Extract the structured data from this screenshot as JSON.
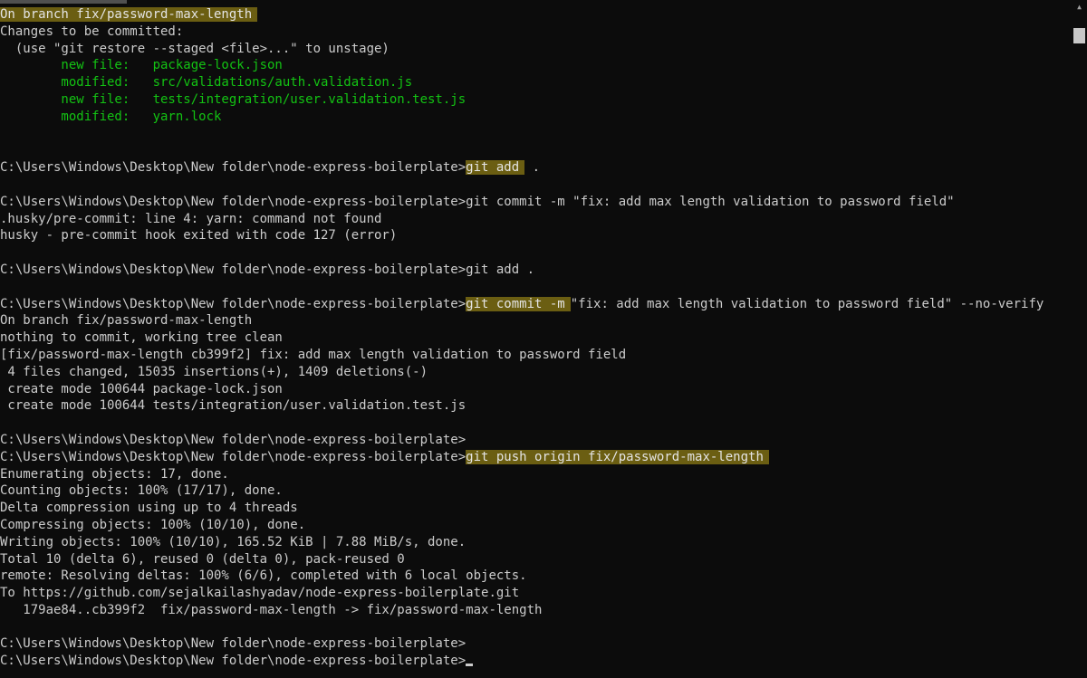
{
  "terminal": {
    "lines": [
      {
        "type": "hl",
        "text": "On branch fix/password-max-length"
      },
      {
        "type": "plain",
        "text": "Changes to be committed:"
      },
      {
        "type": "plain",
        "text": "  (use \"git restore --staged <file>...\" to unstage)"
      },
      {
        "type": "green",
        "text": "        new file:   package-lock.json"
      },
      {
        "type": "green",
        "text": "        modified:   src/validations/auth.validation.js"
      },
      {
        "type": "green",
        "text": "        new file:   tests/integration/user.validation.test.js"
      },
      {
        "type": "green",
        "text": "        modified:   yarn.lock"
      },
      {
        "type": "blank",
        "text": ""
      },
      {
        "type": "blank",
        "text": ""
      },
      {
        "type": "prompt_hl",
        "prompt": "C:\\Users\\Windows\\Desktop\\New folder\\node-express-boilerplate>",
        "cmd": "git add",
        "rest": " ."
      },
      {
        "type": "blank",
        "text": ""
      },
      {
        "type": "plain",
        "text": "C:\\Users\\Windows\\Desktop\\New folder\\node-express-boilerplate>git commit -m \"fix: add max length validation to password field\""
      },
      {
        "type": "plain",
        "text": ".husky/pre-commit: line 4: yarn: command not found"
      },
      {
        "type": "plain",
        "text": "husky - pre-commit hook exited with code 127 (error)"
      },
      {
        "type": "blank",
        "text": ""
      },
      {
        "type": "plain",
        "text": "C:\\Users\\Windows\\Desktop\\New folder\\node-express-boilerplate>git add ."
      },
      {
        "type": "blank",
        "text": ""
      },
      {
        "type": "prompt_hl",
        "prompt": "C:\\Users\\Windows\\Desktop\\New folder\\node-express-boilerplate>",
        "cmd": "git commit -m",
        "rest": "\"fix: add max length validation to password field\" --no-verify"
      },
      {
        "type": "plain",
        "text": "On branch fix/password-max-length"
      },
      {
        "type": "plain",
        "text": "nothing to commit, working tree clean"
      },
      {
        "type": "plain",
        "text": "[fix/password-max-length cb399f2] fix: add max length validation to password field"
      },
      {
        "type": "plain",
        "text": " 4 files changed, 15035 insertions(+), 1409 deletions(-)"
      },
      {
        "type": "plain",
        "text": " create mode 100644 package-lock.json"
      },
      {
        "type": "plain",
        "text": " create mode 100644 tests/integration/user.validation.test.js"
      },
      {
        "type": "blank",
        "text": ""
      },
      {
        "type": "plain",
        "text": "C:\\Users\\Windows\\Desktop\\New folder\\node-express-boilerplate>"
      },
      {
        "type": "prompt_hl",
        "prompt": "C:\\Users\\Windows\\Desktop\\New folder\\node-express-boilerplate>",
        "cmd": "git push origin fix/password-max-length",
        "rest": ""
      },
      {
        "type": "plain",
        "text": "Enumerating objects: 17, done."
      },
      {
        "type": "plain",
        "text": "Counting objects: 100% (17/17), done."
      },
      {
        "type": "plain",
        "text": "Delta compression using up to 4 threads"
      },
      {
        "type": "plain",
        "text": "Compressing objects: 100% (10/10), done."
      },
      {
        "type": "plain",
        "text": "Writing objects: 100% (10/10), 165.52 KiB | 7.88 MiB/s, done."
      },
      {
        "type": "plain",
        "text": "Total 10 (delta 6), reused 0 (delta 0), pack-reused 0"
      },
      {
        "type": "plain",
        "text": "remote: Resolving deltas: 100% (6/6), completed with 6 local objects."
      },
      {
        "type": "plain",
        "text": "To https://github.com/sejalkailashyadav/node-express-boilerplate.git"
      },
      {
        "type": "plain",
        "text": "   179ae84..cb399f2  fix/password-max-length -> fix/password-max-length"
      },
      {
        "type": "blank",
        "text": ""
      },
      {
        "type": "plain",
        "text": "C:\\Users\\Windows\\Desktop\\New folder\\node-express-boilerplate>"
      },
      {
        "type": "cursor",
        "text": "C:\\Users\\Windows\\Desktop\\New folder\\node-express-boilerplate>"
      }
    ],
    "colors": {
      "background": "#0c0c0c",
      "text": "#cccccc",
      "staged": "#13c313",
      "highlight": "#6b5e12"
    }
  }
}
